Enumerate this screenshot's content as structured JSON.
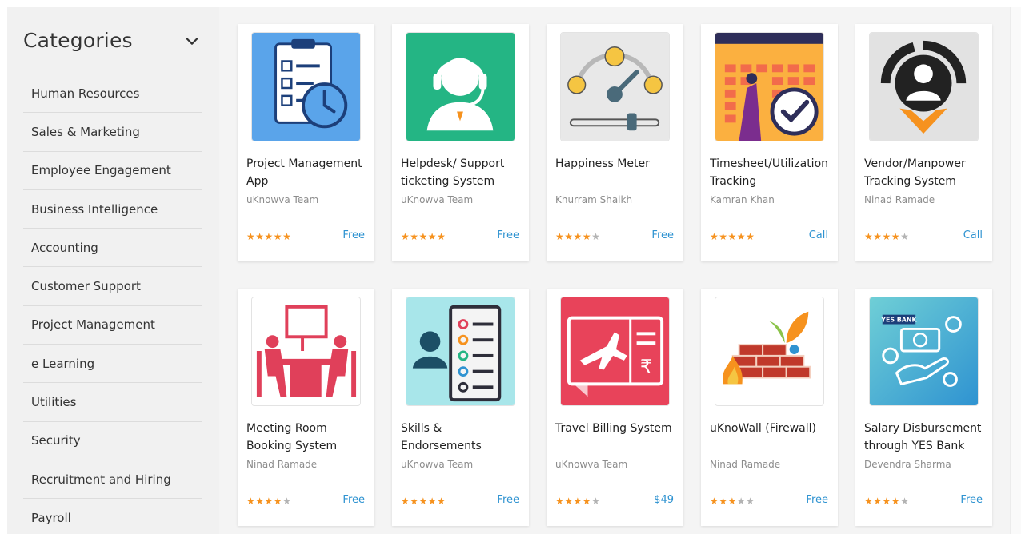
{
  "sidebar": {
    "title": "Categories",
    "items": [
      "Human Resources",
      "Sales & Marketing",
      "Employee Engagement",
      "Business Intelligence",
      "Accounting",
      "Customer Support",
      "Project Management",
      "e Learning",
      "Utilities",
      "Security",
      "Recruitment and Hiring",
      "Payroll"
    ]
  },
  "colors": {
    "star": "#f6921e",
    "star_off": "#b3b3b3",
    "price": "#2f93d1"
  },
  "apps": [
    {
      "title": "Project Management App",
      "author": "uKnowva Team",
      "rating": 5,
      "price": "Free",
      "icon": "clipboard-clock-icon"
    },
    {
      "title": "Helpdesk/ Support ticketing System",
      "author": "uKnowva Team",
      "rating": 5,
      "price": "Free",
      "icon": "headset-agent-icon"
    },
    {
      "title": "Happiness Meter",
      "author": "Khurram Shaikh",
      "rating": 4,
      "price": "Free",
      "icon": "happiness-gauge-icon"
    },
    {
      "title": "Timesheet/Utilization Tracking",
      "author": "Kamran Khan",
      "rating": 5,
      "price": "Call",
      "icon": "calendar-check-icon"
    },
    {
      "title": "Vendor/Manpower Tracking System",
      "author": "Ninad Ramade",
      "rating": 4,
      "price": "Call",
      "icon": "person-location-icon"
    },
    {
      "title": "Meeting Room Booking System",
      "author": "Ninad Ramade",
      "rating": 4,
      "price": "Free",
      "icon": "meeting-room-icon"
    },
    {
      "title": "Skills & Endorsements",
      "author": "uKnowva Team",
      "rating": 5,
      "price": "Free",
      "icon": "skills-list-icon"
    },
    {
      "title": "Travel Billing System",
      "author": "uKnowva Team",
      "rating": 4,
      "price": "$49",
      "icon": "airplane-bill-icon"
    },
    {
      "title": "uKnoWall (Firewall)",
      "author": "Ninad Ramade",
      "rating": 3,
      "price": "Free",
      "icon": "firewall-icon"
    },
    {
      "title": "Salary Disbursement through YES Bank",
      "author": "Devendra Sharma",
      "rating": 4,
      "price": "Free",
      "icon": "bank-payment-icon",
      "logo_text": "YES BANK"
    }
  ]
}
